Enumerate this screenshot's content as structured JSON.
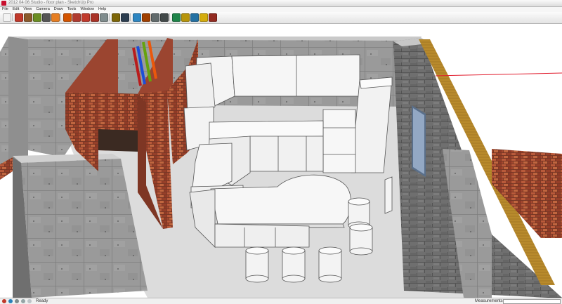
{
  "window": {
    "title": "2012 04 06 Studio - floor plan - SketchUp Pro"
  },
  "menu": {
    "items": [
      {
        "label": "File"
      },
      {
        "label": "Edit"
      },
      {
        "label": "View"
      },
      {
        "label": "Camera"
      },
      {
        "label": "Draw"
      },
      {
        "label": "Tools"
      },
      {
        "label": "Window"
      },
      {
        "label": "Help"
      }
    ]
  },
  "toolbar": {
    "tools": [
      {
        "name": "select-tool-icon",
        "color": "#f2f2f2"
      },
      {
        "name": "pencil-line-icon",
        "color": "#c0392b"
      },
      {
        "name": "rectangle-icon",
        "color": "#8b5a2b"
      },
      {
        "name": "circle-icon",
        "color": "#6b8e23"
      },
      {
        "name": "arc-icon",
        "color": "#555555"
      },
      {
        "name": "eraser-icon",
        "color": "#e67e22"
      },
      {
        "name": "paint-bucket-icon",
        "color": "#d35400"
      },
      {
        "name": "push-pull-icon",
        "color": "#b03a2e"
      },
      {
        "name": "move-icon",
        "color": "#c0392b"
      },
      {
        "name": "rotate-icon",
        "color": "#a93226"
      },
      {
        "name": "offset-icon",
        "color": "#7f8c8d"
      },
      {
        "name": "tape-measure-icon",
        "color": "#7d6608"
      },
      {
        "name": "text-icon",
        "color": "#2c3e50"
      },
      {
        "name": "orbit-icon",
        "color": "#2e86c1"
      },
      {
        "name": "pan-icon",
        "color": "#a04000"
      },
      {
        "name": "zoom-icon",
        "color": "#616a6b"
      },
      {
        "name": "zoom-extents-icon",
        "color": "#424949"
      },
      {
        "name": "previous-view-icon",
        "color": "#1e8449"
      },
      {
        "name": "get-models-icon",
        "color": "#b7950b"
      },
      {
        "name": "share-model-icon",
        "color": "#2471a3"
      },
      {
        "name": "components-icon",
        "color": "#d4ac0d"
      },
      {
        "name": "extension-icon",
        "color": "#922b21"
      }
    ]
  },
  "status": {
    "ready_text": "Ready",
    "measurements_label": "Measurements",
    "measurements_value": ""
  }
}
